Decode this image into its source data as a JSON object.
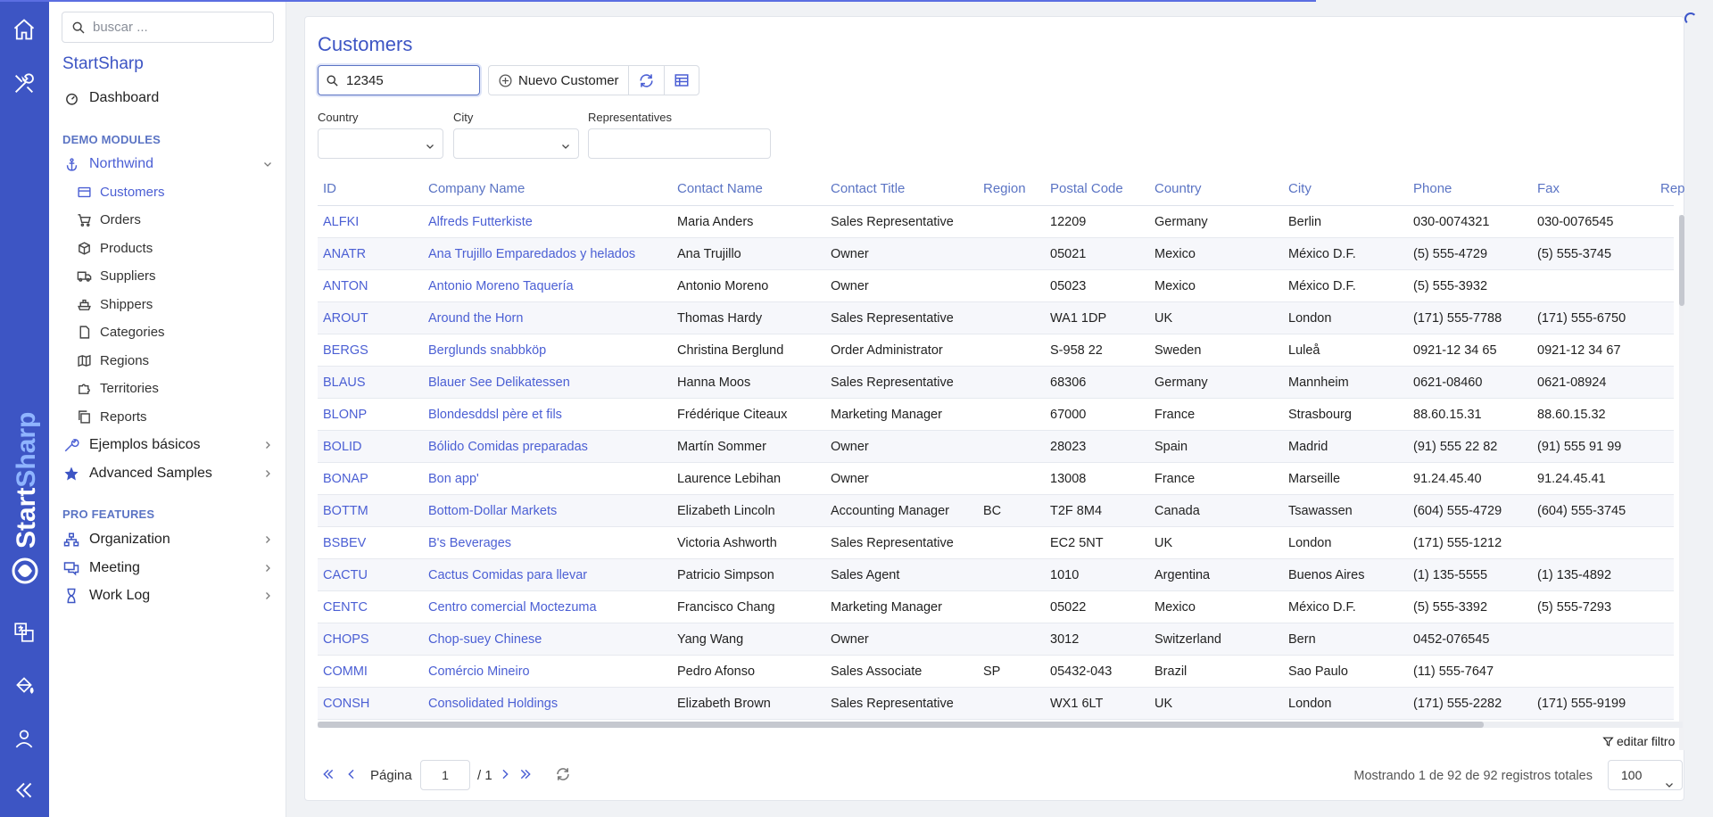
{
  "rail": {
    "brand": "StartSharp",
    "icons": [
      "home-icon",
      "tools-icon",
      "translate-icon",
      "paint-bucket-icon",
      "user-icon",
      "collapse-icon"
    ]
  },
  "sidebar": {
    "search_placeholder": "buscar ...",
    "brand": "StartSharp",
    "dashboard": "Dashboard",
    "section_demo": "DEMO MODULES",
    "northwind": "Northwind",
    "northwind_items": [
      "Customers",
      "Orders",
      "Products",
      "Suppliers",
      "Shippers",
      "Categories",
      "Regions",
      "Territories",
      "Reports"
    ],
    "basic_examples": "Ejemplos básicos",
    "advanced_samples": "Advanced Samples",
    "section_pro": "PRO FEATURES",
    "organization": "Organization",
    "meeting": "Meeting",
    "work_log": "Work Log"
  },
  "page": {
    "title": "Customers",
    "search_value": "12345",
    "new_button": "Nuevo Customer",
    "filters": {
      "country_label": "Country",
      "city_label": "City",
      "representatives_label": "Representatives"
    }
  },
  "grid": {
    "columns": [
      "ID",
      "Company Name",
      "Contact Name",
      "Contact Title",
      "Region",
      "Postal Code",
      "Country",
      "City",
      "Phone",
      "Fax",
      "Rep"
    ],
    "rows": [
      [
        "ALFKI",
        "Alfreds Futterkiste",
        "Maria Anders",
        "Sales Representative",
        "",
        "12209",
        "Germany",
        "Berlin",
        "030-0074321",
        "030-0076545"
      ],
      [
        "ANATR",
        "Ana Trujillo Emparedados y helados",
        "Ana Trujillo",
        "Owner",
        "",
        "05021",
        "Mexico",
        "México D.F.",
        "(5) 555-4729",
        "(5) 555-3745"
      ],
      [
        "ANTON",
        "Antonio Moreno Taquería",
        "Antonio Moreno",
        "Owner",
        "",
        "05023",
        "Mexico",
        "México D.F.",
        "(5) 555-3932",
        ""
      ],
      [
        "AROUT",
        "Around the Horn",
        "Thomas Hardy",
        "Sales Representative",
        "",
        "WA1 1DP",
        "UK",
        "London",
        "(171) 555-7788",
        "(171) 555-6750"
      ],
      [
        "BERGS",
        "Berglunds snabbköp",
        "Christina Berglund",
        "Order Administrator",
        "",
        "S-958 22",
        "Sweden",
        "Luleå",
        "0921-12 34 65",
        "0921-12 34 67"
      ],
      [
        "BLAUS",
        "Blauer See Delikatessen",
        "Hanna Moos",
        "Sales Representative",
        "",
        "68306",
        "Germany",
        "Mannheim",
        "0621-08460",
        "0621-08924"
      ],
      [
        "BLONP",
        "Blondesddsl père et fils",
        "Frédérique Citeaux",
        "Marketing Manager",
        "",
        "67000",
        "France",
        "Strasbourg",
        "88.60.15.31",
        "88.60.15.32"
      ],
      [
        "BOLID",
        "Bólido Comidas preparadas",
        "Martín Sommer",
        "Owner",
        "",
        "28023",
        "Spain",
        "Madrid",
        "(91) 555 22 82",
        "(91) 555 91 99"
      ],
      [
        "BONAP",
        "Bon app'",
        "Laurence Lebihan",
        "Owner",
        "",
        "13008",
        "France",
        "Marseille",
        "91.24.45.40",
        "91.24.45.41"
      ],
      [
        "BOTTM",
        "Bottom-Dollar Markets",
        "Elizabeth Lincoln",
        "Accounting Manager",
        "BC",
        "T2F 8M4",
        "Canada",
        "Tsawassen",
        "(604) 555-4729",
        "(604) 555-3745"
      ],
      [
        "BSBEV",
        "B's Beverages",
        "Victoria Ashworth",
        "Sales Representative",
        "",
        "EC2 5NT",
        "UK",
        "London",
        "(171) 555-1212",
        ""
      ],
      [
        "CACTU",
        "Cactus Comidas para llevar",
        "Patricio Simpson",
        "Sales Agent",
        "",
        "1010",
        "Argentina",
        "Buenos Aires",
        "(1) 135-5555",
        "(1) 135-4892"
      ],
      [
        "CENTC",
        "Centro comercial Moctezuma",
        "Francisco Chang",
        "Marketing Manager",
        "",
        "05022",
        "Mexico",
        "México D.F.",
        "(5) 555-3392",
        "(5) 555-7293"
      ],
      [
        "CHOPS",
        "Chop-suey Chinese",
        "Yang Wang",
        "Owner",
        "",
        "3012",
        "Switzerland",
        "Bern",
        "0452-076545",
        ""
      ],
      [
        "COMMI",
        "Comércio Mineiro",
        "Pedro Afonso",
        "Sales Associate",
        "SP",
        "05432-043",
        "Brazil",
        "Sao Paulo",
        "(11) 555-7647",
        ""
      ],
      [
        "CONSH",
        "Consolidated Holdings",
        "Elizabeth Brown",
        "Sales Representative",
        "",
        "WX1 6LT",
        "UK",
        "London",
        "(171) 555-2282",
        "(171) 555-9199"
      ]
    ]
  },
  "footer": {
    "edit_filter": "editar filtro",
    "page_label": "Página",
    "page_value": "1",
    "page_total": "/ 1",
    "status": "Mostrando 1 de 92 de 92 registros totales",
    "page_size": "100"
  },
  "colors": {
    "accent": "#3d55c4",
    "link": "#4b5fd4",
    "rail": "#3d55c4"
  }
}
